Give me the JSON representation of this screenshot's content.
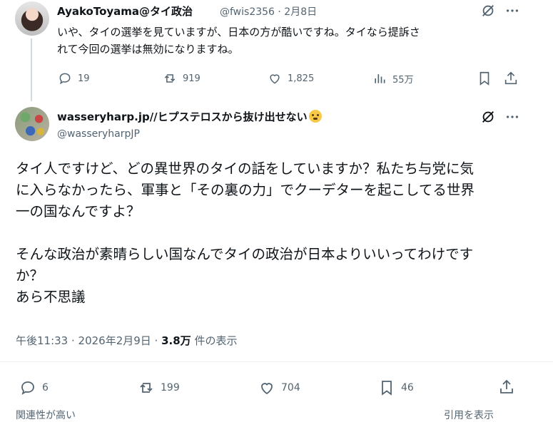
{
  "parent_tweet": {
    "display_name": "AyakoToyama@タイ政治",
    "handle": "@fwis2356",
    "date": "· 2月8日",
    "text_line1": "いや、タイの選挙を見ていますが、日本の方が酷いですね。タイなら提訴さ",
    "text_line2": "れて今回の選挙は無効になりますね。",
    "replies": "19",
    "retweets": "919",
    "likes": "1,825",
    "views": "55万"
  },
  "main_tweet": {
    "display_name": "wasseryharp.jp//ヒプステロスから抜け出せない",
    "handle": "@wasseryharpJP",
    "text_line1": "タイ人ですけど、どの異世界のタイの話をしていますか？私たち与党に気",
    "text_line2": "に入らなかったら、軍事と「その裏の力」でクーデターを起こしてる世界",
    "text_line3": "一の国なんですよ？",
    "text_line4": "そんな政治が素晴らしい国なんでタイの政治が日本よりいいってわけです",
    "text_line5": "か？",
    "text_line6": "あら不思議",
    "timestamp": "午後11:33 · 2026年2月9日 · ",
    "view_count": "3.8万",
    "view_label": " 件の表示",
    "replies": "6",
    "retweets": "199",
    "likes": "704",
    "bookmarks": "46"
  },
  "footer": {
    "left_label": "関連性が高い",
    "right_label": "引用を表示"
  },
  "colors": {
    "text": "#0f1419",
    "secondary": "#536471",
    "divider": "#eff3f4",
    "thread_line": "#cfd9de"
  }
}
